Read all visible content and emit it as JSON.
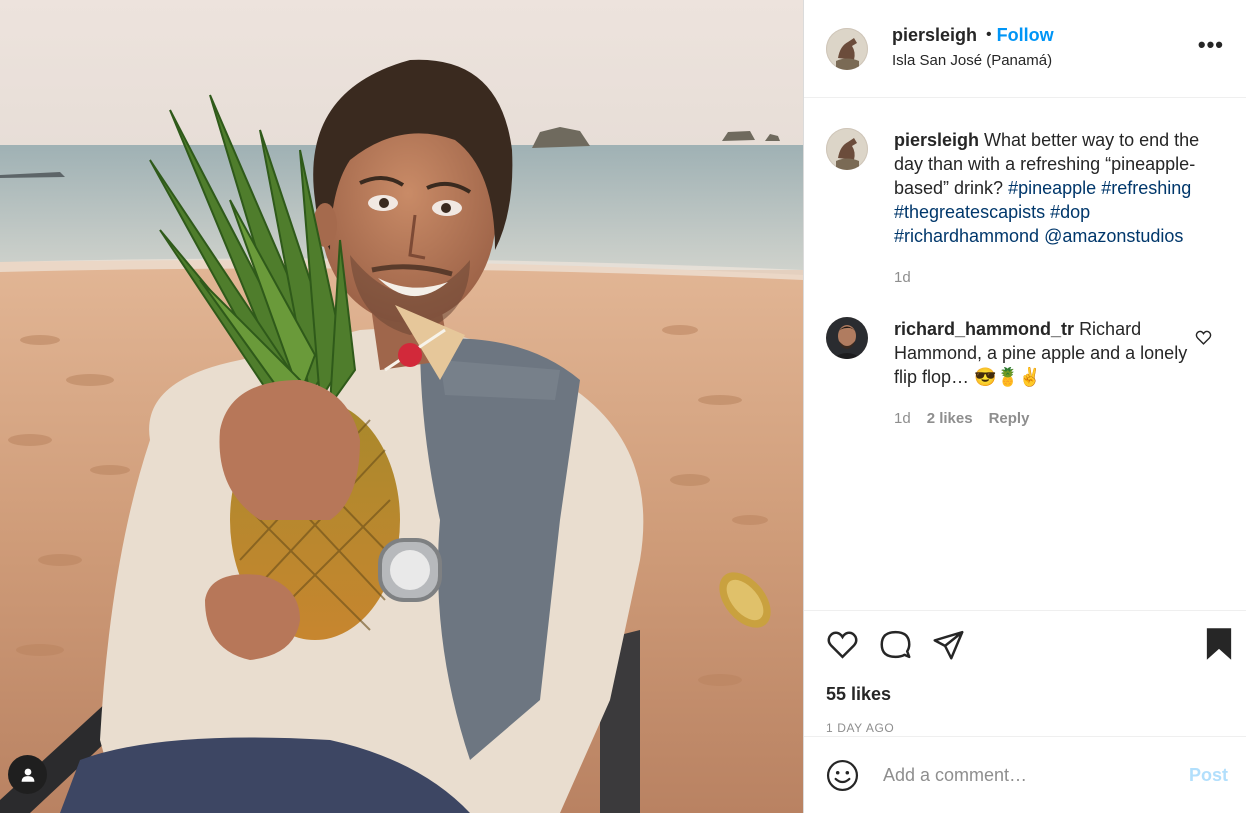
{
  "post": {
    "username": "piersleigh",
    "follow_label": "Follow",
    "dot": "•",
    "location": "Isla San José (Panamá)",
    "more_label": "•••",
    "likes": "55 likes",
    "time_ago": "1 DAY AGO"
  },
  "caption": {
    "username": "piersleigh",
    "text": "What better way to end the day than with a refreshing “pineapple-based” drink?",
    "hashtags": [
      "#pineapple",
      "#refreshing",
      "#thegreatescapists",
      "#dop",
      "#richardhammond"
    ],
    "mention": "@amazonstudios",
    "age": "1d"
  },
  "comment": {
    "username": "richard_hammond_tr",
    "text": "Richard Hammond, a pine apple and a lonely flip flop…",
    "emojis": "😎🍍✌",
    "age": "1d",
    "likes": "2 likes",
    "reply_label": "Reply"
  },
  "add_comment": {
    "placeholder": "Add a comment…",
    "post_label": "Post"
  },
  "icons": {
    "like": "heart-icon",
    "comment": "comment-icon",
    "share": "share-icon",
    "save": "bookmark-icon",
    "emoji": "emoji-icon",
    "tag": "user-tag-icon"
  },
  "colors": {
    "link": "#0095f6",
    "hashtag": "#00376b",
    "muted": "#8e8e8e",
    "post_disabled": "#b2dffc"
  }
}
